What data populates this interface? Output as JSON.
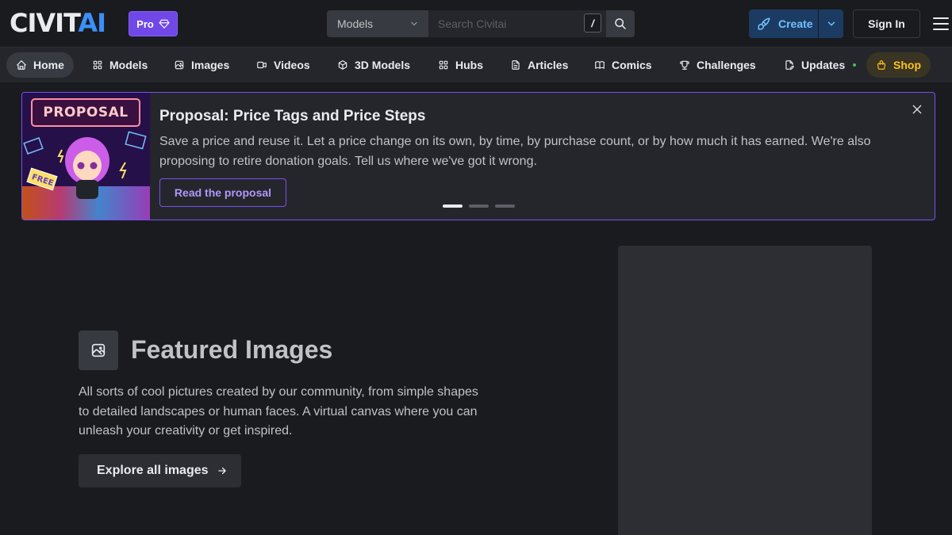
{
  "header": {
    "logo_part1": "CIVIT",
    "logo_part2": "AI",
    "pro_label": "Pro",
    "search_type": "Models",
    "search_placeholder": "Search Civitai",
    "search_shortcut": "/",
    "create_label": "Create",
    "signin_label": "Sign In"
  },
  "nav": {
    "items": [
      {
        "label": "Home",
        "icon": "home-icon"
      },
      {
        "label": "Models",
        "icon": "grid-icon"
      },
      {
        "label": "Images",
        "icon": "photo-icon"
      },
      {
        "label": "Videos",
        "icon": "video-icon"
      },
      {
        "label": "3D Models",
        "icon": "cube-icon"
      },
      {
        "label": "Hubs",
        "icon": "grid-icon"
      },
      {
        "label": "Articles",
        "icon": "file-text-icon"
      },
      {
        "label": "Comics",
        "icon": "book-icon"
      },
      {
        "label": "Challenges",
        "icon": "trophy-icon"
      },
      {
        "label": "Updates",
        "icon": "file-pencil-icon"
      },
      {
        "label": "Shop",
        "icon": "shopping-bag-icon"
      }
    ]
  },
  "banner": {
    "image_text": "PROPOSAL",
    "title": "Proposal: Price Tags and Price Steps",
    "description": "Save a price and reuse it. Let a price change on its own, by time, by purchase count, or by how much it has earned. We're also proposing to retire donation goals. Tell us where we've got it wrong.",
    "cta_label": "Read the proposal",
    "pages": 3,
    "active_page": 1
  },
  "featured": {
    "title": "Featured Images",
    "description": "All sorts of cool pictures created by our community, from simple shapes to detailed landscapes or human faces. A virtual canvas where you can unleash your creativity or get inspired.",
    "button_label": "Explore all images"
  },
  "colors": {
    "background": "#1a1b1e",
    "nav_background": "#25262b",
    "accent_purple": "#7950f2",
    "brand_blue": "#3b8ff7",
    "shop_yellow": "#fcc419",
    "create_blue": "#74c0fc"
  }
}
